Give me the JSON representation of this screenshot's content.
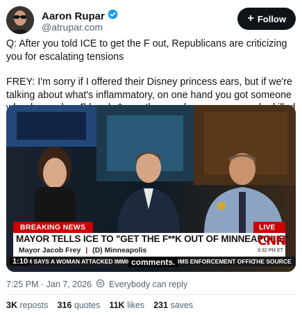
{
  "author": {
    "name": "Aaron Rupar",
    "handle": "@atrupar.com"
  },
  "follow_label": "Follow",
  "post": {
    "paragraph1": "Q: After you told ICE to get the F out, Republicans are criticizing you for escalating tensions",
    "paragraph2": "FREY: I'm sorry if I offered their Disney princess ears, but if we're talking about what's inflammatory, on one hand you got someone who dropped an F bomb & on other you have someone who killed someone"
  },
  "video": {
    "breaking_label": "BREAKING NEWS",
    "live_label": "LIVE",
    "headline": "MAYOR TELLS ICE TO \"GET THE F**K OUT OF MINNEAPOLIS\"",
    "subtitle_name": "Mayor Jacob Frey",
    "subtitle_sep": "|",
    "subtitle_party": "(D) Minneapolis",
    "network_logo": "CNN",
    "network_time": "9:32 PM ET",
    "ticker": "M SAYS A WOMAN ATTACKED IMMIG",
    "ticker_right": "TOMS ENFORCEMENT OFFIC",
    "ticker_source": "THE SOURCE",
    "timecode": "1:10",
    "caption": "comments."
  },
  "meta": {
    "timestamp": "7:25 PM · Jan 7, 2026",
    "reply_setting": "Everybody can reply"
  },
  "stats": {
    "reposts_count": "3K",
    "reposts_label": "reposts",
    "quotes_count": "316",
    "quotes_label": "quotes",
    "likes_count": "11K",
    "likes_label": "likes",
    "saves_count": "231",
    "saves_label": "saves"
  },
  "colors": {
    "follow_bg": "#0f1419",
    "verified": "#1d9bf0",
    "breaking_red": "#cc0000"
  }
}
